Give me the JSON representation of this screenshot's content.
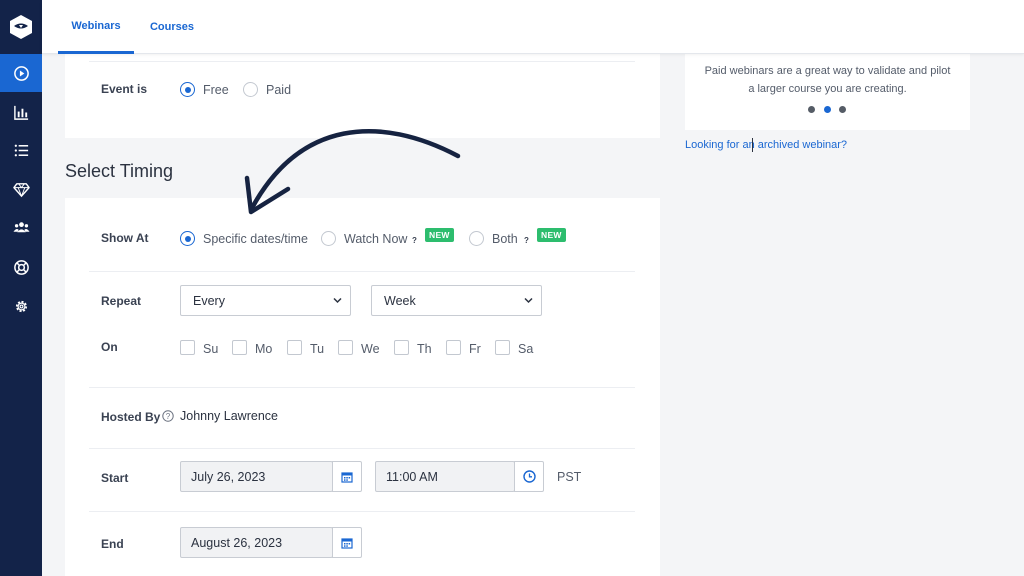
{
  "tabs": [
    "Webinars",
    "Courses"
  ],
  "event": {
    "label": "Event is",
    "options": [
      "Free",
      "Paid"
    ],
    "selected": "Free"
  },
  "section_title": "Select Timing",
  "show_at": {
    "label": "Show At",
    "options": [
      "Specific dates/time",
      "Watch Now",
      "Both"
    ],
    "selected": "Specific dates/time",
    "help": "?",
    "new_badge": "NEW"
  },
  "repeat": {
    "label": "Repeat",
    "frequency": "Every",
    "unit": "Week"
  },
  "on": {
    "label": "On",
    "days": [
      "Su",
      "Mo",
      "Tu",
      "We",
      "Th",
      "Fr",
      "Sa"
    ]
  },
  "hosted_by": {
    "label": "Hosted By",
    "help": "?",
    "value": "Johnny Lawrence"
  },
  "start": {
    "label": "Start",
    "date": "July 26, 2023",
    "time": "11:00 AM",
    "timezone": "PST"
  },
  "end": {
    "label": "End",
    "date": "August 26, 2023"
  },
  "info": {
    "line1": "Paid webinars are a great way to validate and pilot",
    "line2": "a larger course you are creating.",
    "carousel_index": 2,
    "carousel_count": 3
  },
  "archived_link": "Looking for an archived webinar?",
  "colors": {
    "sidebar": "#132349",
    "accent": "#1a67d2",
    "new_badge": "#2dbd6e"
  },
  "icons": [
    "logo-icon",
    "play-icon",
    "bar-chart-icon",
    "list-icon",
    "gem-icon",
    "users-icon",
    "lifebuoy-icon",
    "gear-icon",
    "calendar-icon",
    "clock-icon",
    "chevron-down-icon",
    "help-icon"
  ]
}
